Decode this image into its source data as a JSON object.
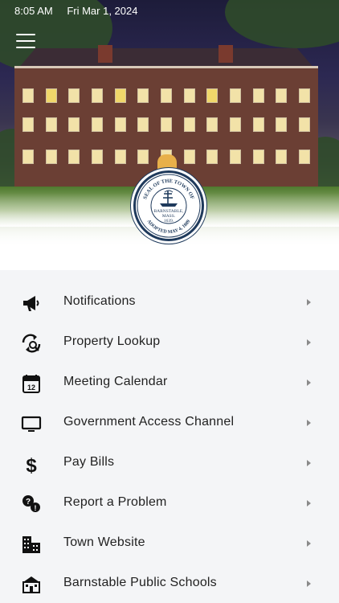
{
  "status_bar": {
    "time": "8:05 AM",
    "date": "Fri Mar 1, 2024"
  },
  "seal": {
    "top_text": "SEAL OF THE TOWN OF",
    "bottom_text": "ADOPTED MAY 4, 1889",
    "center_line1": "BARNSTABLE,",
    "center_line2": "MASS.",
    "center_line3": "1639."
  },
  "menu": {
    "items": [
      {
        "label": "Notifications",
        "icon": "megaphone-icon"
      },
      {
        "label": "Property Lookup",
        "icon": "property-lookup-icon"
      },
      {
        "label": "Meeting Calendar",
        "icon": "calendar-icon"
      },
      {
        "label": "Government Access Channel",
        "icon": "tv-monitor-icon"
      },
      {
        "label": "Pay Bills",
        "icon": "dollar-icon"
      },
      {
        "label": "Report a Problem",
        "icon": "report-problem-icon"
      },
      {
        "label": "Town Website",
        "icon": "town-building-icon"
      },
      {
        "label": "Barnstable Public Schools",
        "icon": "school-icon"
      }
    ]
  },
  "colors": {
    "seal_navy": "#1f3a5c",
    "menu_bg": "#f4f5f7",
    "text": "#222222"
  }
}
